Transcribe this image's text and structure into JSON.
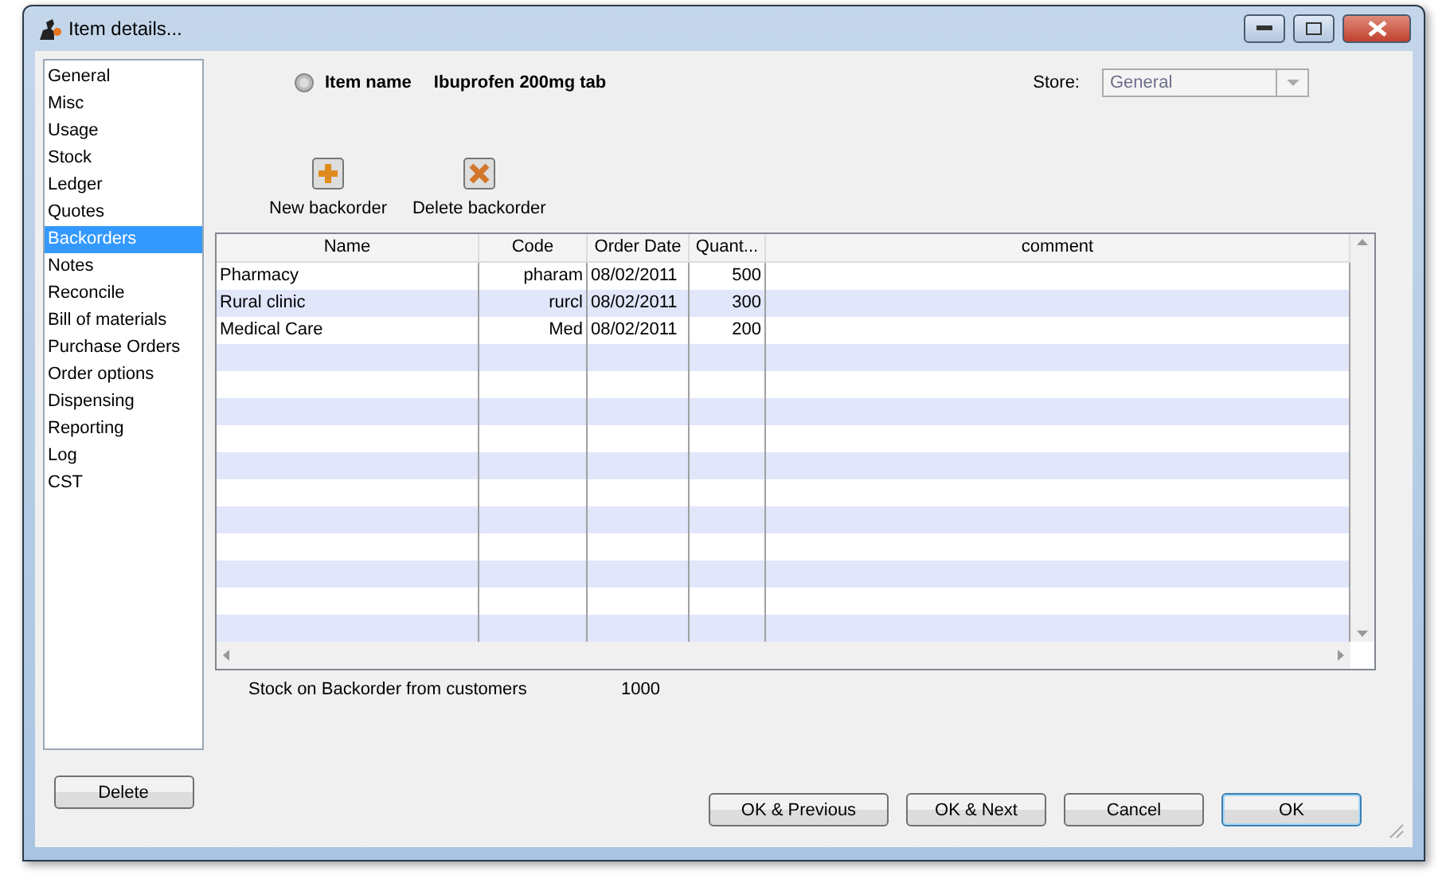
{
  "window": {
    "title": "Item details..."
  },
  "sidebar": {
    "items": [
      {
        "label": "General",
        "selected": false
      },
      {
        "label": "Misc",
        "selected": false
      },
      {
        "label": "Usage",
        "selected": false
      },
      {
        "label": "Stock",
        "selected": false
      },
      {
        "label": "Ledger",
        "selected": false
      },
      {
        "label": "Quotes",
        "selected": false
      },
      {
        "label": "Backorders",
        "selected": true
      },
      {
        "label": "Notes",
        "selected": false
      },
      {
        "label": "Reconcile",
        "selected": false
      },
      {
        "label": "Bill of materials",
        "selected": false
      },
      {
        "label": "Purchase Orders",
        "selected": false
      },
      {
        "label": "Order options",
        "selected": false
      },
      {
        "label": "Dispensing",
        "selected": false
      },
      {
        "label": "Reporting",
        "selected": false
      },
      {
        "label": "Log",
        "selected": false
      },
      {
        "label": "CST",
        "selected": false
      }
    ],
    "delete_button": "Delete"
  },
  "item": {
    "label": "Item name",
    "value": "Ibuprofen 200mg tab"
  },
  "store": {
    "label": "Store:",
    "value": "General",
    "disabled": true
  },
  "toolbar": [
    {
      "kind": "add",
      "label": "New backorder"
    },
    {
      "kind": "delete",
      "label": "Delete backorder"
    }
  ],
  "table": {
    "columns": [
      {
        "label": "Name"
      },
      {
        "label": "Code"
      },
      {
        "label": "Order Date"
      },
      {
        "label": "Quant..."
      },
      {
        "label": "comment"
      }
    ],
    "rows": [
      [
        "Pharmacy",
        "pharam",
        "08/02/2011",
        "500",
        ""
      ],
      [
        "Rural clinic",
        "rurcl",
        "08/02/2011",
        "300",
        ""
      ],
      [
        "Medical Care",
        "Med",
        "08/02/2011",
        "200",
        ""
      ]
    ]
  },
  "summary": {
    "label": "Stock on Backorder from customers",
    "value": "1000"
  },
  "buttons": [
    {
      "label": "OK & Previous",
      "default": false
    },
    {
      "label": "OK & Next",
      "default": false
    },
    {
      "label": "Cancel",
      "default": false
    },
    {
      "label": "OK",
      "default": true
    }
  ]
}
